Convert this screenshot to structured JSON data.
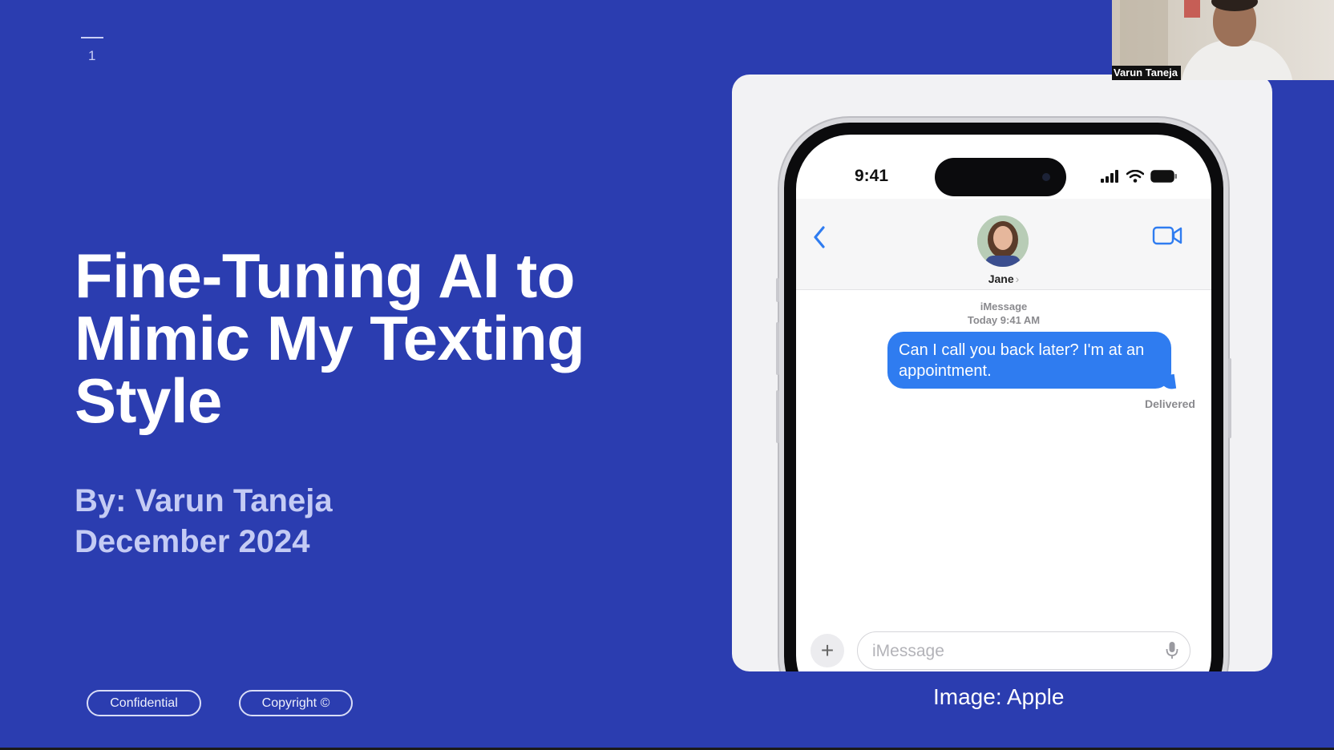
{
  "slide": {
    "page_number": "1",
    "title_lines": [
      "Fine-Tuning AI to",
      "Mimic My Texting",
      "Style"
    ],
    "byline_lines": [
      "By: Varun Taneja",
      "December 2024"
    ],
    "tags": {
      "confidential": "Confidential",
      "copyright": "Copyright ©"
    },
    "image_caption": "Image: Apple",
    "colors": {
      "background": "#2b3db0",
      "byline": "#c4cbf4"
    }
  },
  "phone": {
    "status_time": "9:41",
    "contact_name": "Jane",
    "contact_chevron": "›",
    "icons": {
      "back": "chevron-left-icon",
      "video": "video-camera-icon",
      "signal": "cellular-signal-icon",
      "wifi": "wifi-icon",
      "battery": "battery-icon",
      "add": "plus-icon",
      "mic": "microphone-icon"
    },
    "service_label": "iMessage",
    "timestamp": "Today 9:41 AM",
    "message": "Can I call you back later? I'm at an appointment.",
    "delivery_status": "Delivered",
    "input_placeholder": "iMessage",
    "add_symbol": "+",
    "colors": {
      "bubble": "#2f7cf0",
      "accent": "#2f7cf0"
    }
  },
  "video_call": {
    "participant_name": "Varun Taneja"
  }
}
